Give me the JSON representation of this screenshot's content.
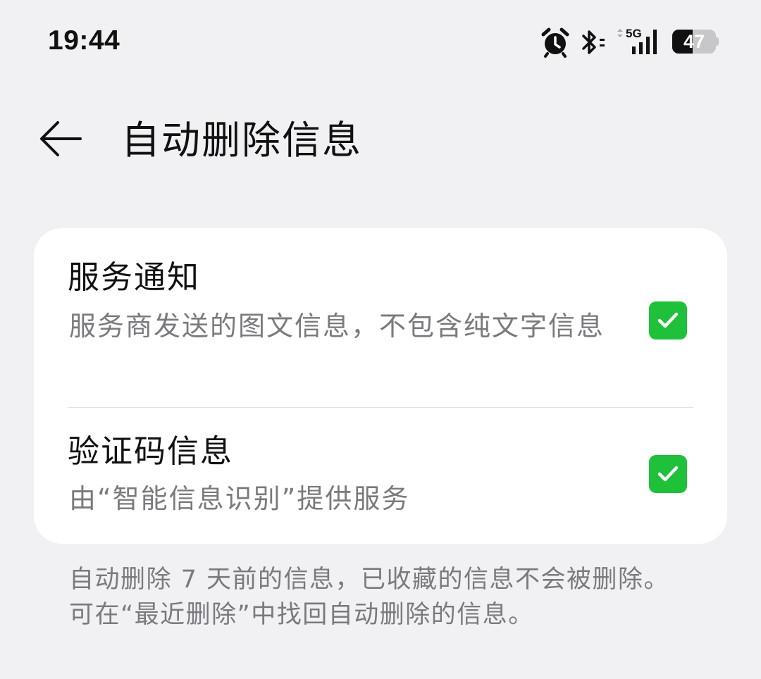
{
  "status_bar": {
    "time": "19:44",
    "network": "5G",
    "battery": "47",
    "icons": [
      "alarm-icon",
      "bluetooth-icon",
      "signal-icon",
      "battery-icon"
    ]
  },
  "header": {
    "back_icon": "arrow-left-icon",
    "title": "自动删除信息"
  },
  "settings": [
    {
      "title": "服务通知",
      "description": "服务商发送的图文信息，不包含纯文字信息",
      "checked": true
    },
    {
      "title": "验证码信息",
      "description": "由“智能信息识别”提供服务",
      "checked": true
    }
  ],
  "footer": {
    "note": "自动删除 7 天前的信息，已收藏的信息不会被删除。可在“最近删除”中找回自动删除的信息。"
  },
  "colors": {
    "background": "#f1f1f3",
    "card": "#ffffff",
    "accent_green": "#1fc13a",
    "secondary_text": "#7a7a7e"
  }
}
